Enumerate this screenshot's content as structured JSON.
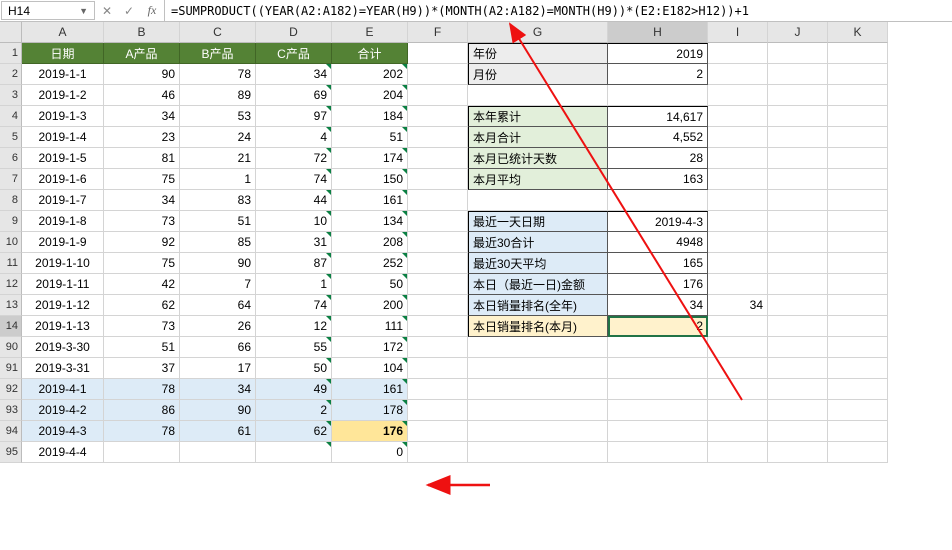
{
  "nameBox": "H14",
  "formula": "=SUMPRODUCT((YEAR(A2:A182)=YEAR(H9))*(MONTH(A2:A182)=MONTH(H9))*(E2:E182>H12))+1",
  "cols": [
    "A",
    "B",
    "C",
    "D",
    "E",
    "F",
    "G",
    "H",
    "I",
    "J",
    "K"
  ],
  "selectedCol": "H",
  "selectedRow": "14",
  "header": [
    "日期",
    "A产品",
    "B产品",
    "C产品",
    "合计"
  ],
  "leftRows": [
    {
      "r": "2",
      "d": "2019-1-1",
      "a": 90,
      "b": 78,
      "c": 34,
      "e": 202
    },
    {
      "r": "3",
      "d": "2019-1-2",
      "a": 46,
      "b": 89,
      "c": 69,
      "e": 204
    },
    {
      "r": "4",
      "d": "2019-1-3",
      "a": 34,
      "b": 53,
      "c": 97,
      "e": 184
    },
    {
      "r": "5",
      "d": "2019-1-4",
      "a": 23,
      "b": 24,
      "c": 4,
      "e": 51
    },
    {
      "r": "6",
      "d": "2019-1-5",
      "a": 81,
      "b": 21,
      "c": 72,
      "e": 174
    },
    {
      "r": "7",
      "d": "2019-1-6",
      "a": 75,
      "b": 1,
      "c": 74,
      "e": 150
    },
    {
      "r": "8",
      "d": "2019-1-7",
      "a": 34,
      "b": 83,
      "c": 44,
      "e": 161
    },
    {
      "r": "9",
      "d": "2019-1-8",
      "a": 73,
      "b": 51,
      "c": 10,
      "e": 134
    },
    {
      "r": "10",
      "d": "2019-1-9",
      "a": 92,
      "b": 85,
      "c": 31,
      "e": 208
    },
    {
      "r": "11",
      "d": "2019-1-10",
      "a": 75,
      "b": 90,
      "c": 87,
      "e": 252
    },
    {
      "r": "12",
      "d": "2019-1-11",
      "a": 42,
      "b": 7,
      "c": 1,
      "e": 50
    },
    {
      "r": "13",
      "d": "2019-1-12",
      "a": 62,
      "b": 64,
      "c": 74,
      "e": 200
    },
    {
      "r": "14",
      "d": "2019-1-13",
      "a": 73,
      "b": 26,
      "c": 12,
      "e": 111
    },
    {
      "r": "90",
      "d": "2019-3-30",
      "a": 51,
      "b": 66,
      "c": 55,
      "e": 172
    },
    {
      "r": "91",
      "d": "2019-3-31",
      "a": 37,
      "b": 17,
      "c": 50,
      "e": 104
    },
    {
      "r": "92",
      "d": "2019-4-1",
      "a": 78,
      "b": 34,
      "c": 49,
      "e": 161,
      "blue": true
    },
    {
      "r": "93",
      "d": "2019-4-2",
      "a": 86,
      "b": 90,
      "c": 2,
      "e": 178,
      "blue": true
    },
    {
      "r": "94",
      "d": "2019-4-3",
      "a": 78,
      "b": 61,
      "c": 62,
      "e": 176,
      "blue": true,
      "hiE": true
    },
    {
      "r": "95",
      "d": "2019-4-4",
      "a": "",
      "b": "",
      "c": "",
      "e": 0
    }
  ],
  "rightTop": [
    {
      "g": "年份",
      "h": "2019",
      "gcls": "gray-bg"
    },
    {
      "g": "月份",
      "h": "2",
      "gcls": "gray-bg"
    }
  ],
  "rightMid": [
    {
      "g": "本年累计",
      "h": "14,617",
      "gcls": "green-bg"
    },
    {
      "g": "本月合计",
      "h": "4,552",
      "gcls": "green-bg"
    },
    {
      "g": "本月已统计天数",
      "h": "28",
      "gcls": "green-bg"
    },
    {
      "g": "本月平均",
      "h": "163",
      "gcls": "green-bg"
    }
  ],
  "rightBot": [
    {
      "g": "最近一天日期",
      "h": "2019-4-3",
      "gcls": "blue-bg"
    },
    {
      "g": "最近30合计",
      "h": "4948",
      "gcls": "blue-bg"
    },
    {
      "g": "最近30天平均",
      "h": "165",
      "gcls": "blue-bg"
    },
    {
      "g": "本日（最近一日)金额",
      "h": "176",
      "gcls": "blue-bg"
    },
    {
      "g": "本日销量排名(全年)",
      "h": "34",
      "gcls": "blue-bg",
      "i": "34"
    },
    {
      "g": "本日销量排名(本月)",
      "h": "2",
      "gcls": "yellow-light",
      "sel": true
    }
  ]
}
